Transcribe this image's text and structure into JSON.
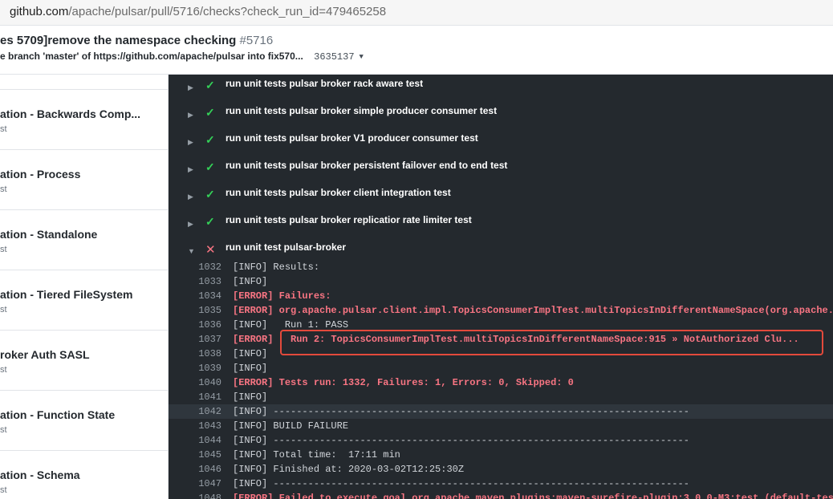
{
  "browser": {
    "url_host": "github.com",
    "url_path": "/apache/pulsar/pull/5716/checks?check_run_id=479465258"
  },
  "pr": {
    "title": "es 5709]remove the namespace checking",
    "number": "#5716",
    "commit_message": "e branch 'master' of https://github.com/apache/pulsar into fix570...",
    "commit_sha": "3635137"
  },
  "sidebar": {
    "items": [
      {
        "title": "ation - Backwards Comp...",
        "sub": "st"
      },
      {
        "title": "ation - Process",
        "sub": "st"
      },
      {
        "title": "ation - Standalone",
        "sub": "st"
      },
      {
        "title": "ation - Tiered FileSystem",
        "sub": "st"
      },
      {
        "title": "roker Auth SASL",
        "sub": "st"
      },
      {
        "title": "ation - Function State",
        "sub": "st"
      },
      {
        "title": "ation - Schema",
        "sub": "st"
      }
    ]
  },
  "steps": [
    {
      "label": "run unit tests pulsar broker rack aware test",
      "status": "success"
    },
    {
      "label": "run unit tests pulsar broker simple producer consumer test",
      "status": "success"
    },
    {
      "label": "run unit tests pulsar broker V1 producer consumer test",
      "status": "success"
    },
    {
      "label": "run unit tests pulsar broker persistent failover end to end test",
      "status": "success"
    },
    {
      "label": "run unit tests pulsar broker client integration test",
      "status": "success"
    },
    {
      "label": "run unit tests pulsar broker replicatior rate limiter test",
      "status": "success"
    },
    {
      "label": "run unit test pulsar-broker",
      "status": "failure"
    }
  ],
  "log": [
    {
      "num": "1032",
      "tag": "[INFO]",
      "text": " Results:"
    },
    {
      "num": "1033",
      "tag": "[INFO]",
      "text": ""
    },
    {
      "num": "1034",
      "tag": "[ERROR]",
      "text": " Failures:"
    },
    {
      "num": "1035",
      "tag": "[ERROR]",
      "text": " org.apache.pulsar.client.impl.TopicsConsumerImplTest.multiTopicsInDifferentNameSpace(org.apache.pu"
    },
    {
      "num": "1036",
      "tag": "[INFO]",
      "text": "   Run 1: PASS"
    },
    {
      "num": "1037",
      "tag": "[ERROR]",
      "text": "   Run 2: TopicsConsumerImplTest.multiTopicsInDifferentNameSpace:915 » NotAuthorized Clu..."
    },
    {
      "num": "1038",
      "tag": "[INFO]",
      "text": ""
    },
    {
      "num": "1039",
      "tag": "[INFO]",
      "text": ""
    },
    {
      "num": "1040",
      "tag": "[ERROR]",
      "text": " Tests run: 1332, Failures: 1, Errors: 0, Skipped: 0"
    },
    {
      "num": "1041",
      "tag": "[INFO]",
      "text": ""
    },
    {
      "num": "1042",
      "tag": "[INFO]",
      "text": " ------------------------------------------------------------------------"
    },
    {
      "num": "1043",
      "tag": "[INFO]",
      "text": " BUILD FAILURE"
    },
    {
      "num": "1044",
      "tag": "[INFO]",
      "text": " ------------------------------------------------------------------------"
    },
    {
      "num": "1045",
      "tag": "[INFO]",
      "text": " Total time:  17:11 min"
    },
    {
      "num": "1046",
      "tag": "[INFO]",
      "text": " Finished at: 2020-03-02T12:25:30Z"
    },
    {
      "num": "1047",
      "tag": "[INFO]",
      "text": " ------------------------------------------------------------------------"
    },
    {
      "num": "1048",
      "tag": "[ERROR]",
      "text": " Failed to execute goal org.apache.maven.plugins:maven-surefire-plugin:3.0.0-M3:test (default-test"
    }
  ],
  "highlighted_line": "1042",
  "colors": {
    "log_bg": "#24292e",
    "success": "#34d058",
    "error": "#f97583",
    "annotation_box": "#e34a3c"
  },
  "icons": {
    "step_expand": "chevron-right-icon",
    "step_collapse": "chevron-down-icon",
    "success": "check-icon",
    "failure": "x-icon"
  }
}
